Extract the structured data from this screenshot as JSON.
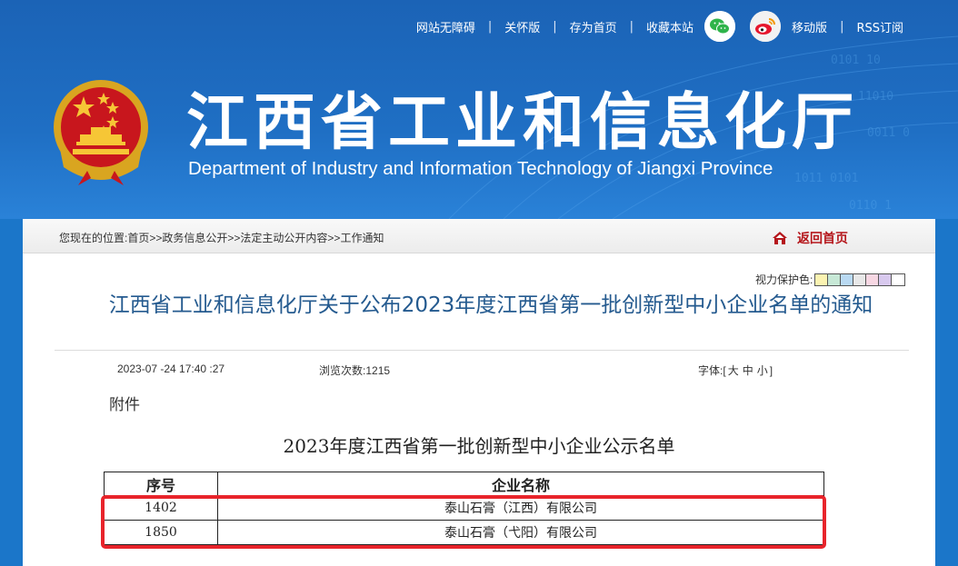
{
  "topnav": {
    "accessibility": "网站无障碍",
    "care_mode": "关怀版",
    "set_home": "存为首页",
    "bookmark": "收藏本站",
    "mobile": "移动版",
    "rss": "RSS订阅",
    "separator": "|"
  },
  "site": {
    "title": "江西省工业和信息化厅",
    "subtitle": "Department of Industry and Information Technology of Jiangxi Province"
  },
  "breadcrumb": {
    "prefix": "您现在的位置:",
    "items": [
      "首页",
      "政务信息公开",
      "法定主动公开内容",
      "工作通知"
    ],
    "sep": ">>"
  },
  "home_link": "返回首页",
  "eye_protect": {
    "label": "视力保护色:",
    "colors": [
      "#fbf3b1",
      "#c7e8d6",
      "#b9d9f2",
      "#e8e8e8",
      "#f7d7e3",
      "#d8c9ee",
      "#ffffff"
    ]
  },
  "article": {
    "title": "江西省工业和信息化厅关于公布2023年度江西省第一批创新型中小企业名单的通知",
    "date": "2023-07 -24 17:40 :27",
    "views_label": "浏览次数:",
    "views": "1215",
    "font_label": "字体:",
    "font_open": "[",
    "font_sizes": [
      "大",
      "中",
      "小"
    ],
    "font_close": "]",
    "attachment": "附件",
    "table_title": "2023年度江西省第一批创新型中小企业公示名单",
    "table": {
      "headers": [
        "序号",
        "企业名称"
      ],
      "rows": [
        [
          "1402",
          "泰山石膏（江西）有限公司"
        ],
        [
          "1850",
          "泰山石膏（弋阳）有限公司"
        ]
      ]
    }
  },
  "colors": {
    "header_blue": "#1f6fc4",
    "title_blue": "#245a8f",
    "highlight_red": "#e8242b",
    "home_red": "#b5171c"
  }
}
